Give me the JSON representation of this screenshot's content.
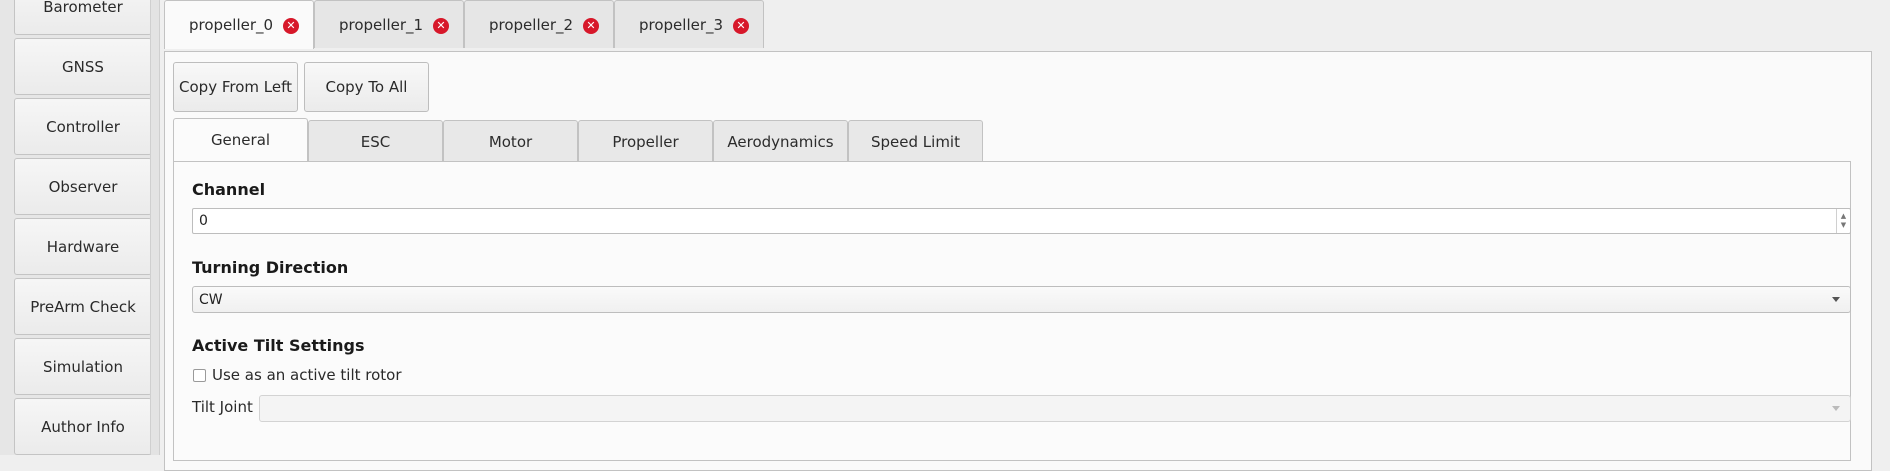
{
  "sidebar": {
    "items": [
      {
        "label": "Barometer"
      },
      {
        "label": "GNSS"
      },
      {
        "label": "Controller"
      },
      {
        "label": "Observer"
      },
      {
        "label": "Hardware"
      },
      {
        "label": "PreArm Check"
      },
      {
        "label": "Simulation"
      },
      {
        "label": "Author Info"
      }
    ]
  },
  "outer_tabs": [
    {
      "label": "propeller_0",
      "active": true
    },
    {
      "label": "propeller_1",
      "active": false
    },
    {
      "label": "propeller_2",
      "active": false
    },
    {
      "label": "propeller_3",
      "active": false
    }
  ],
  "actions": {
    "copy_from_left": "Copy From Left",
    "copy_to_all": "Copy To All"
  },
  "inner_tabs": [
    {
      "label": "General",
      "active": true
    },
    {
      "label": "ESC",
      "active": false
    },
    {
      "label": "Motor",
      "active": false
    },
    {
      "label": "Propeller",
      "active": false
    },
    {
      "label": "Aerodynamics",
      "active": false
    },
    {
      "label": "Speed Limit",
      "active": false
    }
  ],
  "general": {
    "channel": {
      "title": "Channel",
      "value": "0"
    },
    "turning_direction": {
      "title": "Turning Direction",
      "value": "CW"
    },
    "active_tilt": {
      "title": "Active Tilt Settings",
      "checkbox_label": "Use as an active tilt rotor",
      "checked": false,
      "tilt_joint_label": "Tilt Joint",
      "tilt_joint_value": ""
    }
  },
  "colors": {
    "close_icon": "#d7182a"
  }
}
